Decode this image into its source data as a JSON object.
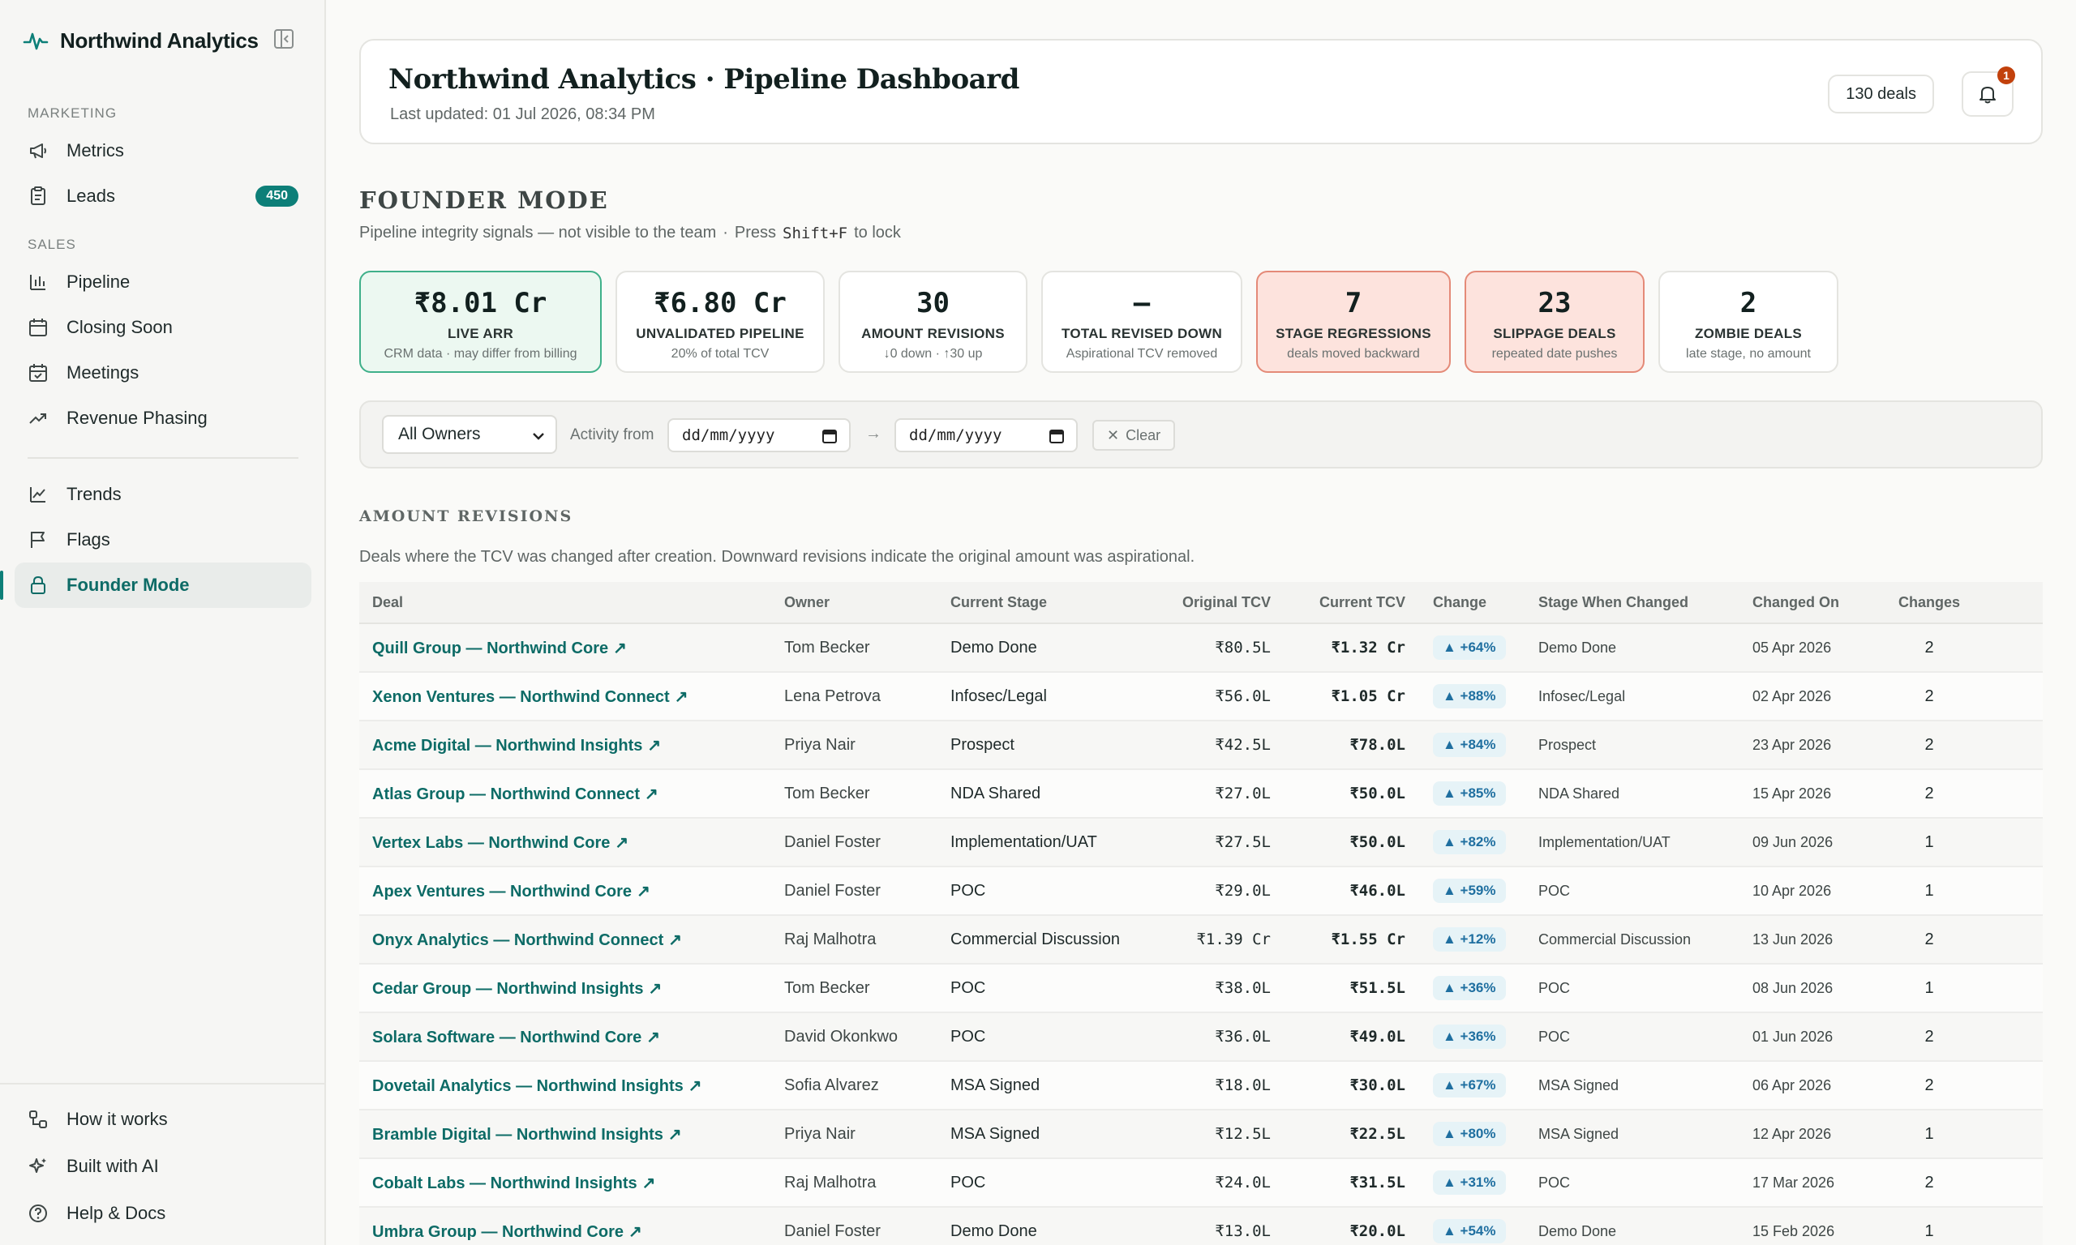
{
  "app": {
    "name": "Northwind Analytics"
  },
  "sidebar": {
    "sections": [
      {
        "label": "MARKETING",
        "items": [
          {
            "label": "Metrics"
          },
          {
            "label": "Leads",
            "badge": "450"
          }
        ]
      },
      {
        "label": "SALES",
        "items": [
          {
            "label": "Pipeline"
          },
          {
            "label": "Closing Soon"
          },
          {
            "label": "Meetings"
          },
          {
            "label": "Revenue Phasing"
          }
        ]
      }
    ],
    "more": [
      {
        "label": "Trends"
      },
      {
        "label": "Flags"
      },
      {
        "label": "Founder Mode",
        "active": true
      }
    ],
    "bottom": [
      {
        "label": "How it works"
      },
      {
        "label": "Built with AI"
      },
      {
        "label": "Help & Docs"
      }
    ]
  },
  "header": {
    "title": "Northwind Analytics · Pipeline Dashboard",
    "updated": "Last updated: 01 Jul 2026, 08:34 PM",
    "deals_count": "130 deals",
    "notifications": "1"
  },
  "founder": {
    "title": "FOUNDER MODE",
    "subtitle": "Pipeline integrity signals — not visible to the team",
    "press": "Press",
    "shortcut": "Shift+F",
    "to_lock": "to lock"
  },
  "kpis": [
    {
      "value": "₹8.01 Cr",
      "label": "LIVE ARR",
      "note": "CRM data · may differ from billing",
      "tone": "green"
    },
    {
      "value": "₹6.80 Cr",
      "label": "UNVALIDATED PIPELINE",
      "note": "20% of total TCV",
      "tone": "plain"
    },
    {
      "value": "30",
      "label": "AMOUNT REVISIONS",
      "note": "↓0 down · ↑30 up",
      "tone": "plain"
    },
    {
      "value": "—",
      "label": "TOTAL REVISED DOWN",
      "note": "Aspirational TCV removed",
      "tone": "plain"
    },
    {
      "value": "7",
      "label": "STAGE REGRESSIONS",
      "note": "deals moved backward",
      "tone": "red"
    },
    {
      "value": "23",
      "label": "SLIPPAGE DEALS",
      "note": "repeated date pushes",
      "tone": "red"
    },
    {
      "value": "2",
      "label": "ZOMBIE DEALS",
      "note": "late stage, no amount",
      "tone": "plain"
    }
  ],
  "filters": {
    "owner": "All Owners",
    "activity_label": "Activity from",
    "from_placeholder": "dd/mm/yyyy",
    "to_placeholder": "dd/mm/yyyy",
    "arrow": "→",
    "clear": "Clear"
  },
  "revisions": {
    "title": "AMOUNT REVISIONS",
    "description": "Deals where the TCV was changed after creation. Downward revisions indicate the original amount was aspirational.",
    "columns": [
      "Deal",
      "Owner",
      "Current Stage",
      "Original TCV",
      "Current TCV",
      "Change",
      "Stage When Changed",
      "Changed On",
      "Changes"
    ],
    "rows": [
      {
        "deal": "Quill Group — Northwind Core",
        "owner": "Tom Becker",
        "stage": "Demo Done",
        "orig": "₹80.5L",
        "cur": "₹1.32 Cr",
        "chg": "▲ +64%",
        "swc": "Demo Done",
        "date": "05 Apr 2026",
        "n": "2"
      },
      {
        "deal": "Xenon Ventures — Northwind Connect",
        "owner": "Lena Petrova",
        "stage": "Infosec/Legal",
        "orig": "₹56.0L",
        "cur": "₹1.05 Cr",
        "chg": "▲ +88%",
        "swc": "Infosec/Legal",
        "date": "02 Apr 2026",
        "n": "2"
      },
      {
        "deal": "Acme Digital — Northwind Insights",
        "owner": "Priya Nair",
        "stage": "Prospect",
        "orig": "₹42.5L",
        "cur": "₹78.0L",
        "chg": "▲ +84%",
        "swc": "Prospect",
        "date": "23 Apr 2026",
        "n": "2"
      },
      {
        "deal": "Atlas Group — Northwind Connect",
        "owner": "Tom Becker",
        "stage": "NDA Shared",
        "orig": "₹27.0L",
        "cur": "₹50.0L",
        "chg": "▲ +85%",
        "swc": "NDA Shared",
        "date": "15 Apr 2026",
        "n": "2"
      },
      {
        "deal": "Vertex Labs — Northwind Core",
        "owner": "Daniel Foster",
        "stage": "Implementation/UAT",
        "orig": "₹27.5L",
        "cur": "₹50.0L",
        "chg": "▲ +82%",
        "swc": "Implementation/UAT",
        "date": "09 Jun 2026",
        "n": "1"
      },
      {
        "deal": "Apex Ventures — Northwind Core",
        "owner": "Daniel Foster",
        "stage": "POC",
        "orig": "₹29.0L",
        "cur": "₹46.0L",
        "chg": "▲ +59%",
        "swc": "POC",
        "date": "10 Apr 2026",
        "n": "1"
      },
      {
        "deal": "Onyx Analytics — Northwind Connect",
        "owner": "Raj Malhotra",
        "stage": "Commercial Discussion",
        "orig": "₹1.39 Cr",
        "cur": "₹1.55 Cr",
        "chg": "▲ +12%",
        "swc": "Commercial Discussion",
        "date": "13 Jun 2026",
        "n": "2"
      },
      {
        "deal": "Cedar Group — Northwind Insights",
        "owner": "Tom Becker",
        "stage": "POC",
        "orig": "₹38.0L",
        "cur": "₹51.5L",
        "chg": "▲ +36%",
        "swc": "POC",
        "date": "08 Jun 2026",
        "n": "1"
      },
      {
        "deal": "Solara Software — Northwind Core",
        "owner": "David Okonkwo",
        "stage": "POC",
        "orig": "₹36.0L",
        "cur": "₹49.0L",
        "chg": "▲ +36%",
        "swc": "POC",
        "date": "01 Jun 2026",
        "n": "2"
      },
      {
        "deal": "Dovetail Analytics — Northwind Insights",
        "owner": "Sofia Alvarez",
        "stage": "MSA Signed",
        "orig": "₹18.0L",
        "cur": "₹30.0L",
        "chg": "▲ +67%",
        "swc": "MSA Signed",
        "date": "06 Apr 2026",
        "n": "2"
      },
      {
        "deal": "Bramble Digital — Northwind Insights",
        "owner": "Priya Nair",
        "stage": "MSA Signed",
        "orig": "₹12.5L",
        "cur": "₹22.5L",
        "chg": "▲ +80%",
        "swc": "MSA Signed",
        "date": "12 Apr 2026",
        "n": "1"
      },
      {
        "deal": "Cobalt Labs — Northwind Insights",
        "owner": "Raj Malhotra",
        "stage": "POC",
        "orig": "₹24.0L",
        "cur": "₹31.5L",
        "chg": "▲ +31%",
        "swc": "POC",
        "date": "17 Mar 2026",
        "n": "2"
      },
      {
        "deal": "Umbra Group — Northwind Core",
        "owner": "Daniel Foster",
        "stage": "Demo Done",
        "orig": "₹13.0L",
        "cur": "₹20.0L",
        "chg": "▲ +54%",
        "swc": "Demo Done",
        "date": "15 Feb 2026",
        "n": "1"
      }
    ]
  },
  "colors": {
    "accent": "#0d7f78",
    "link": "#0d6b66",
    "danger_bg": "#fde3dd",
    "success_bg": "#ecf8f1"
  }
}
